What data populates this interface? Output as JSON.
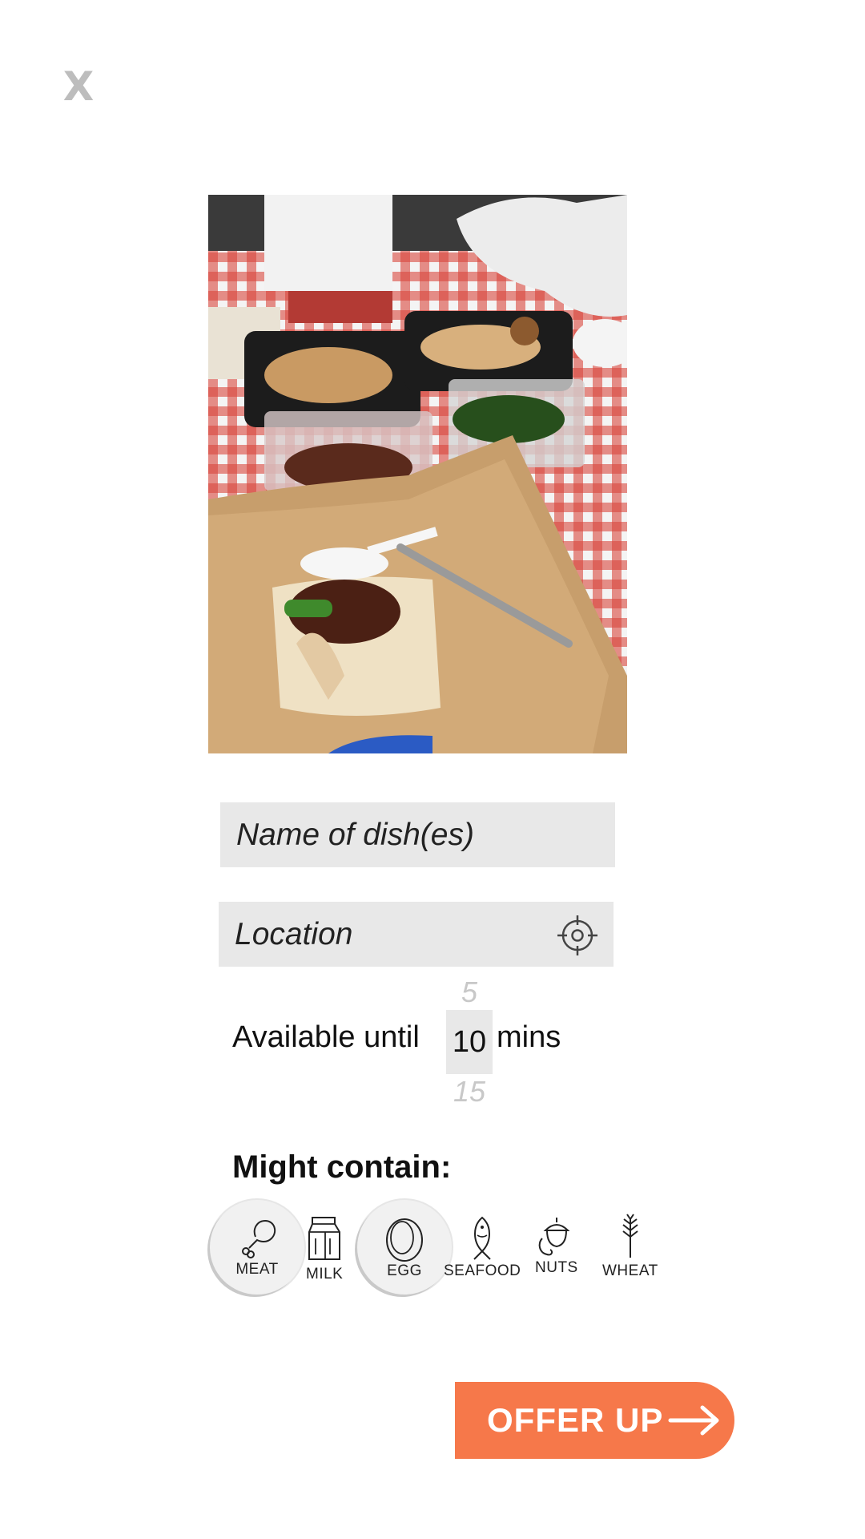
{
  "close_label": "X",
  "form": {
    "name_placeholder": "Name of dish(es)",
    "location_placeholder": "Location",
    "available_label": "Available until",
    "picker": {
      "prev": "5",
      "current": "10",
      "next": "15"
    },
    "unit_label": "mins",
    "might_contain_label": "Might contain:"
  },
  "allergens": [
    {
      "label": "MEAT",
      "icon": "drumstick-icon",
      "selected": true
    },
    {
      "label": "MILK",
      "icon": "milk-carton-icon",
      "selected": false
    },
    {
      "label": "EGG",
      "icon": "egg-icon",
      "selected": true
    },
    {
      "label": "SEAFOOD",
      "icon": "fish-icon",
      "selected": false
    },
    {
      "label": "NUTS",
      "icon": "nut-icon",
      "selected": false
    },
    {
      "label": "WHEAT",
      "icon": "wheat-icon",
      "selected": false
    }
  ],
  "offer_button": {
    "label": "OFFER UP",
    "color": "#f6784a"
  },
  "colors": {
    "field_bg": "#e8e8e8",
    "accent": "#f6784a"
  }
}
